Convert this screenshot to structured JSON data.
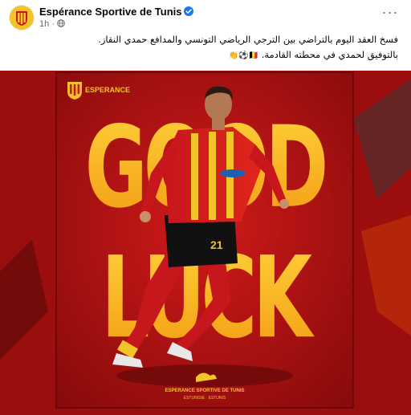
{
  "post": {
    "author": "Espérance Sportive de Tunis",
    "timestamp": "1h",
    "meta_separator": "·",
    "more_label": "···",
    "caption_line1": "فسخ العقد اليوم بالتراضي بين الترجي الرياضي التونسي والمدافع حمدي النقاز.",
    "caption_line2": "بالتوفيق لحمدي في محطته القادمة.",
    "caption_emojis": "🇧🇪⚽👏"
  },
  "poster": {
    "headline_top": "GOOD",
    "headline_bottom": "LUCK",
    "club_wordmark": "ESPERANCE",
    "jersey_number": "21",
    "footer_line1": "ESPERANCE SPORTIVE DE TUNIS",
    "footer_line2": "ESTUNISIE · ESTUNIS",
    "crest_letters": "EST"
  },
  "colors": {
    "brand_red": "#c8161d",
    "brand_gold": "#f2c42a",
    "poster_background": "#9c0e0e",
    "verified_blue": "#1877f2"
  },
  "icons": {
    "avatar": "club-crest-icon",
    "verified": "verified-badge-icon",
    "privacy": "globe-icon",
    "menu": "more-options-icon"
  }
}
